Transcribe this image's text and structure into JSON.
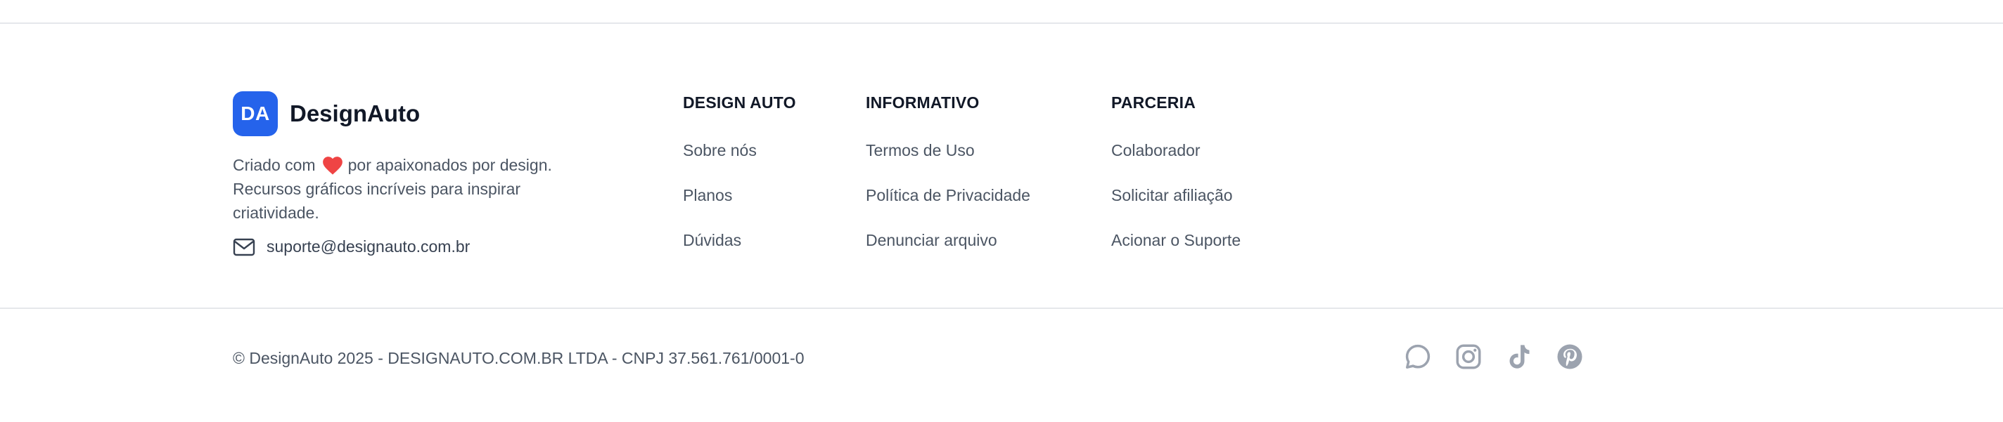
{
  "brand": {
    "logo_initials": "DA",
    "name": "DesignAuto",
    "tagline_prefix": "Criado com",
    "tagline_suffix": "por apaixonados por design.",
    "tagline_rest": "Recursos gráficos incríveis para inspirar criatividade.",
    "email": "suporte@designauto.com.br"
  },
  "columns": [
    {
      "title": "DESIGN AUTO",
      "links": [
        "Sobre nós",
        "Planos",
        "Dúvidas"
      ]
    },
    {
      "title": "INFORMATIVO",
      "links": [
        "Termos de Uso",
        "Política de Privacidade",
        "Denunciar arquivo"
      ]
    },
    {
      "title": "PARCERIA",
      "links": [
        "Colaborador",
        "Solicitar afiliação",
        "Acionar o Suporte"
      ]
    }
  ],
  "footer": {
    "copyright": "© DesignAuto 2025 - DESIGNAUTO.COM.BR LTDA - CNPJ 37.561.761/0001-0"
  },
  "socials": [
    "whatsapp-icon",
    "instagram-icon",
    "tiktok-icon",
    "pinterest-icon"
  ],
  "colors": {
    "brand_blue": "#2563eb",
    "heart_red": "#ef4444",
    "icon_gray": "#9ca3af"
  }
}
